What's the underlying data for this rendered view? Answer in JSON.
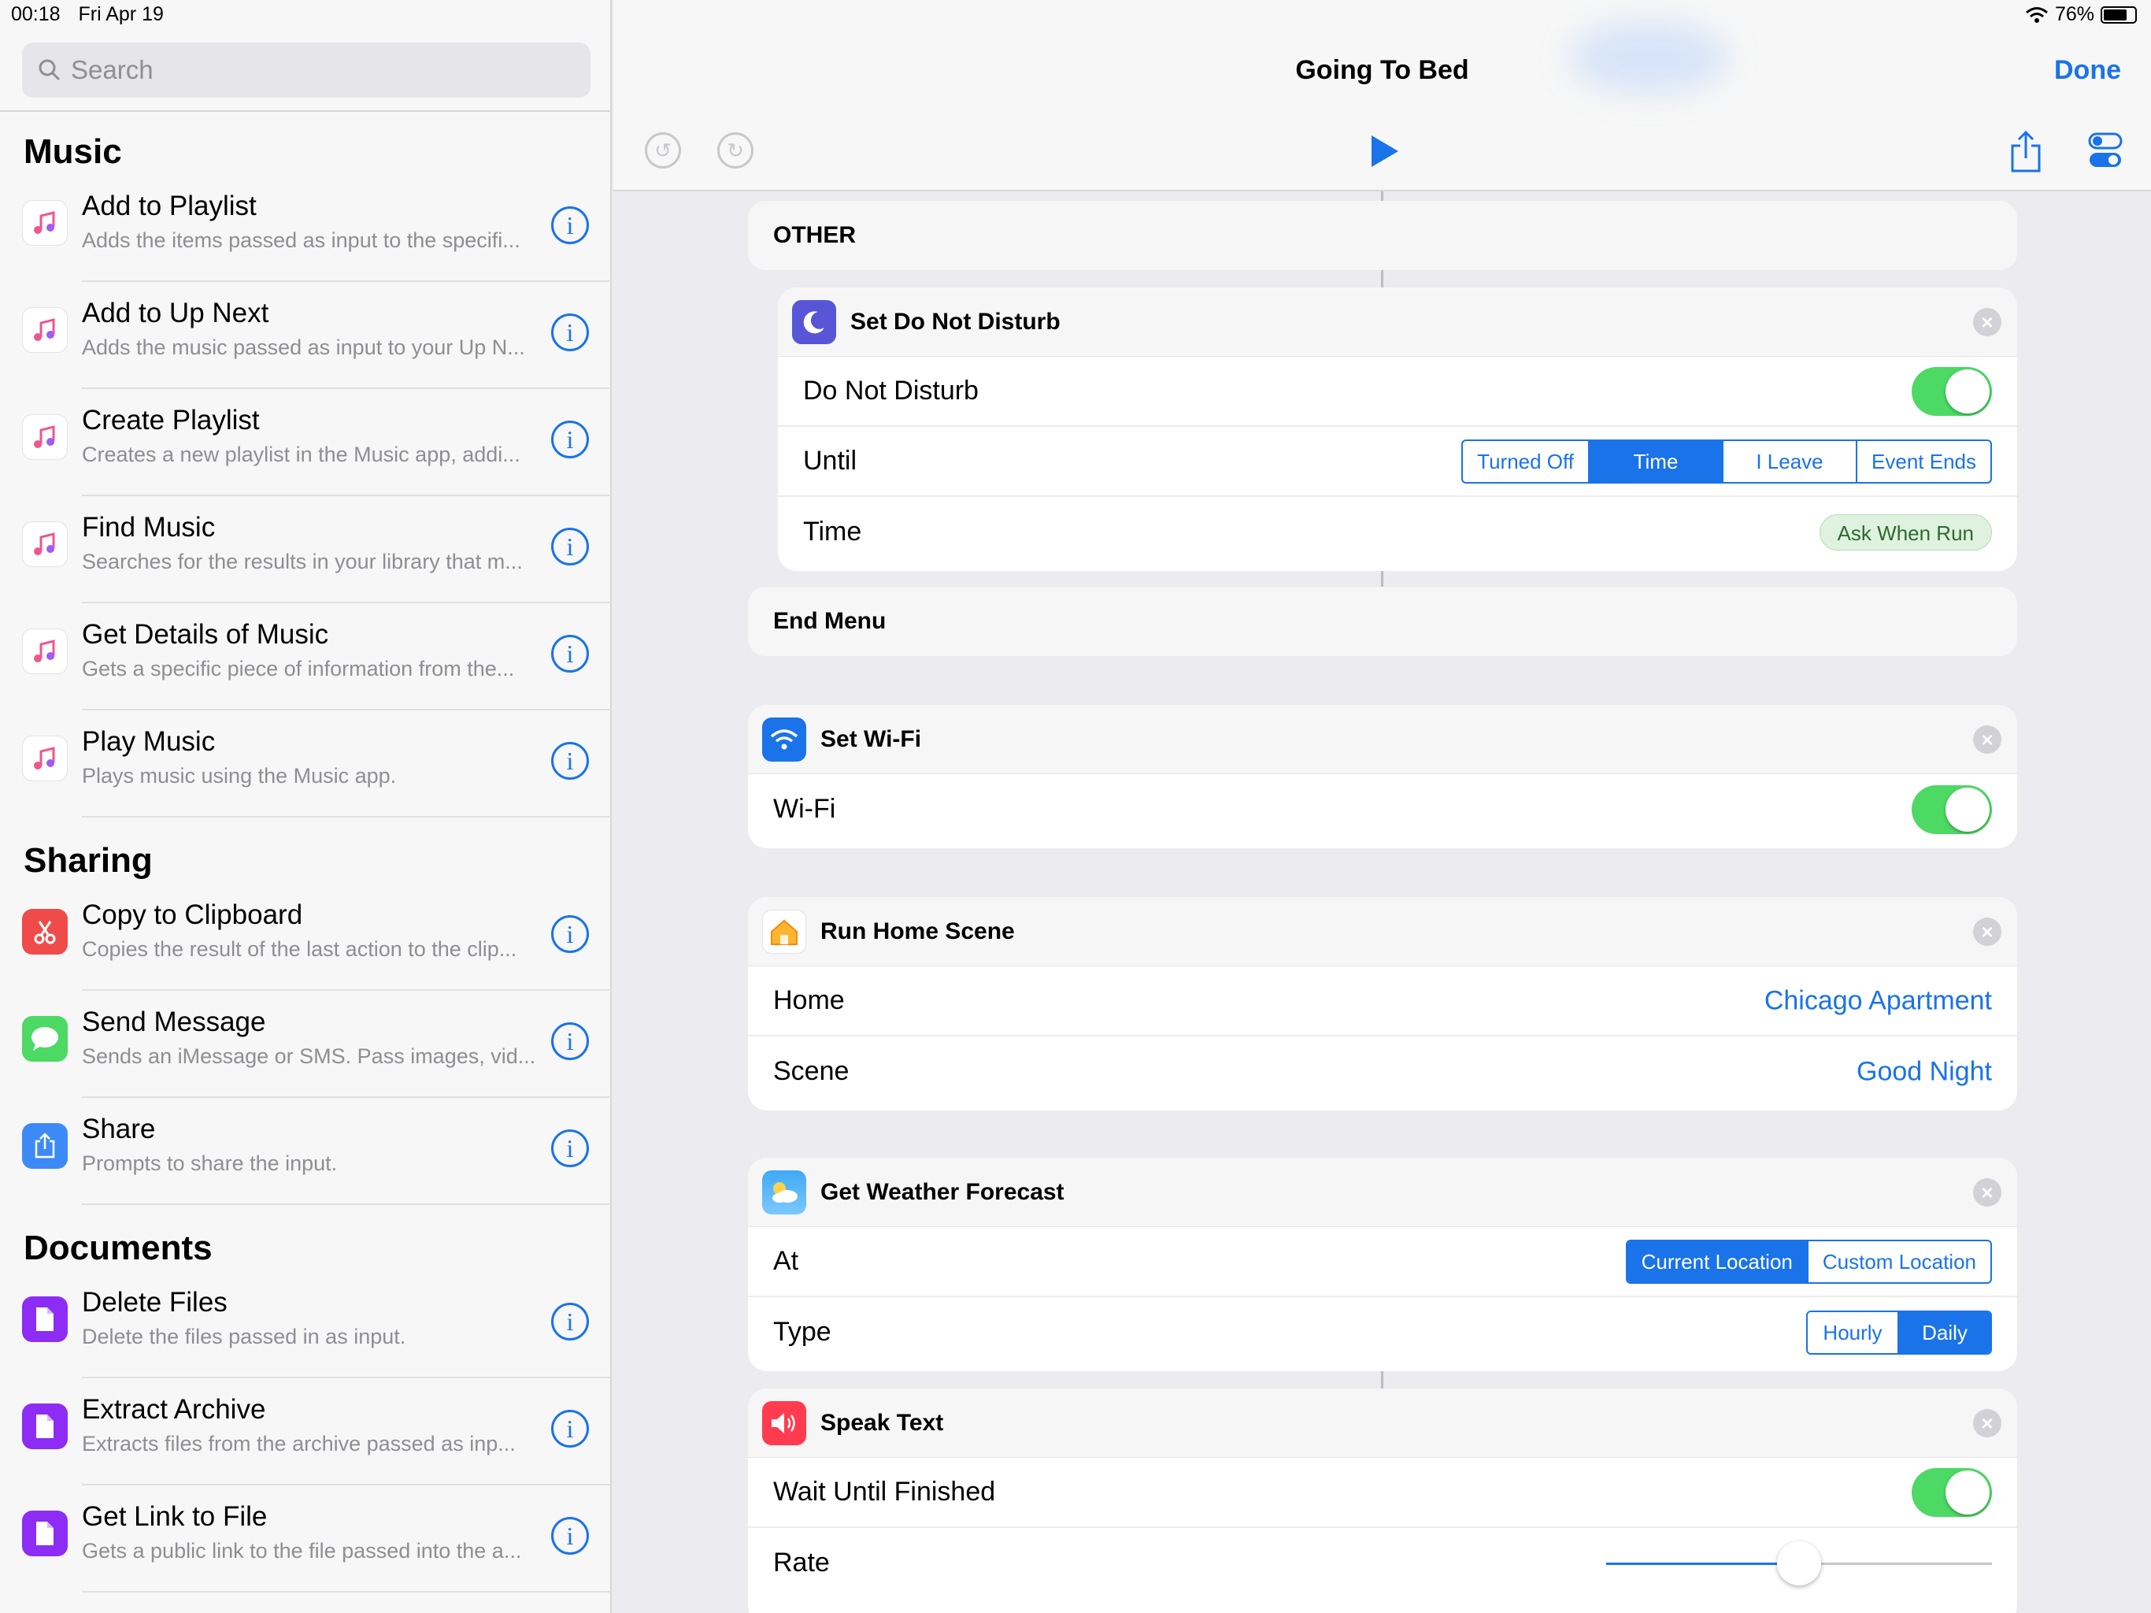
{
  "status": {
    "time": "00:18",
    "date": "Fri Apr 19",
    "battery": "76%"
  },
  "sidebar": {
    "search_placeholder": "Search",
    "sections": [
      {
        "title": "Music",
        "items": [
          {
            "title": "Add to Playlist",
            "desc": "Adds the items passed as input to the specifi..."
          },
          {
            "title": "Add to Up Next",
            "desc": "Adds the music passed as input to your Up N..."
          },
          {
            "title": "Create Playlist",
            "desc": "Creates a new playlist in the Music app, addi..."
          },
          {
            "title": "Find Music",
            "desc": "Searches for the results in your library that m..."
          },
          {
            "title": "Get Details of Music",
            "desc": "Gets a specific piece of information from the..."
          },
          {
            "title": "Play Music",
            "desc": "Plays music using the Music app."
          }
        ]
      },
      {
        "title": "Sharing",
        "items": [
          {
            "title": "Copy to Clipboard",
            "desc": "Copies the result of the last action to the clip..."
          },
          {
            "title": "Send Message",
            "desc": "Sends an iMessage or SMS. Pass images, vid..."
          },
          {
            "title": "Share",
            "desc": "Prompts to share the input."
          }
        ]
      },
      {
        "title": "Documents",
        "items": [
          {
            "title": "Delete Files",
            "desc": "Delete the files passed in as input."
          },
          {
            "title": "Extract Archive",
            "desc": "Extracts files from the archive passed as inp..."
          },
          {
            "title": "Get Link to File",
            "desc": "Gets a public link to the file passed into the a..."
          }
        ]
      }
    ]
  },
  "editor": {
    "title": "Going To Bed",
    "done_label": "Done",
    "other_label": "OTHER",
    "end_menu_label": "End Menu",
    "dnd": {
      "title": "Set Do Not Disturb",
      "toggle_label": "Do Not Disturb",
      "toggle_on": true,
      "until_label": "Until",
      "until_options": [
        "Turned Off",
        "Time",
        "I Leave",
        "Event Ends"
      ],
      "until_selected": "Time",
      "time_label": "Time",
      "time_value": "Ask When Run"
    },
    "wifi": {
      "title": "Set Wi-Fi",
      "toggle_label": "Wi-Fi",
      "toggle_on": true
    },
    "home": {
      "title": "Run Home Scene",
      "home_label": "Home",
      "home_value": "Chicago Apartment",
      "scene_label": "Scene",
      "scene_value": "Good Night"
    },
    "weather": {
      "title": "Get Weather Forecast",
      "at_label": "At",
      "at_options": [
        "Current Location",
        "Custom Location"
      ],
      "at_selected": "Current Location",
      "type_label": "Type",
      "type_options": [
        "Hourly",
        "Daily"
      ],
      "type_selected": "Daily"
    },
    "speak": {
      "title": "Speak Text",
      "wait_label": "Wait Until Finished",
      "wait_on": true,
      "rate_label": "Rate",
      "rate_value": 0.5
    },
    "colors": {
      "accent": "#1a73e8",
      "toggle_green": "#4cd964"
    }
  }
}
